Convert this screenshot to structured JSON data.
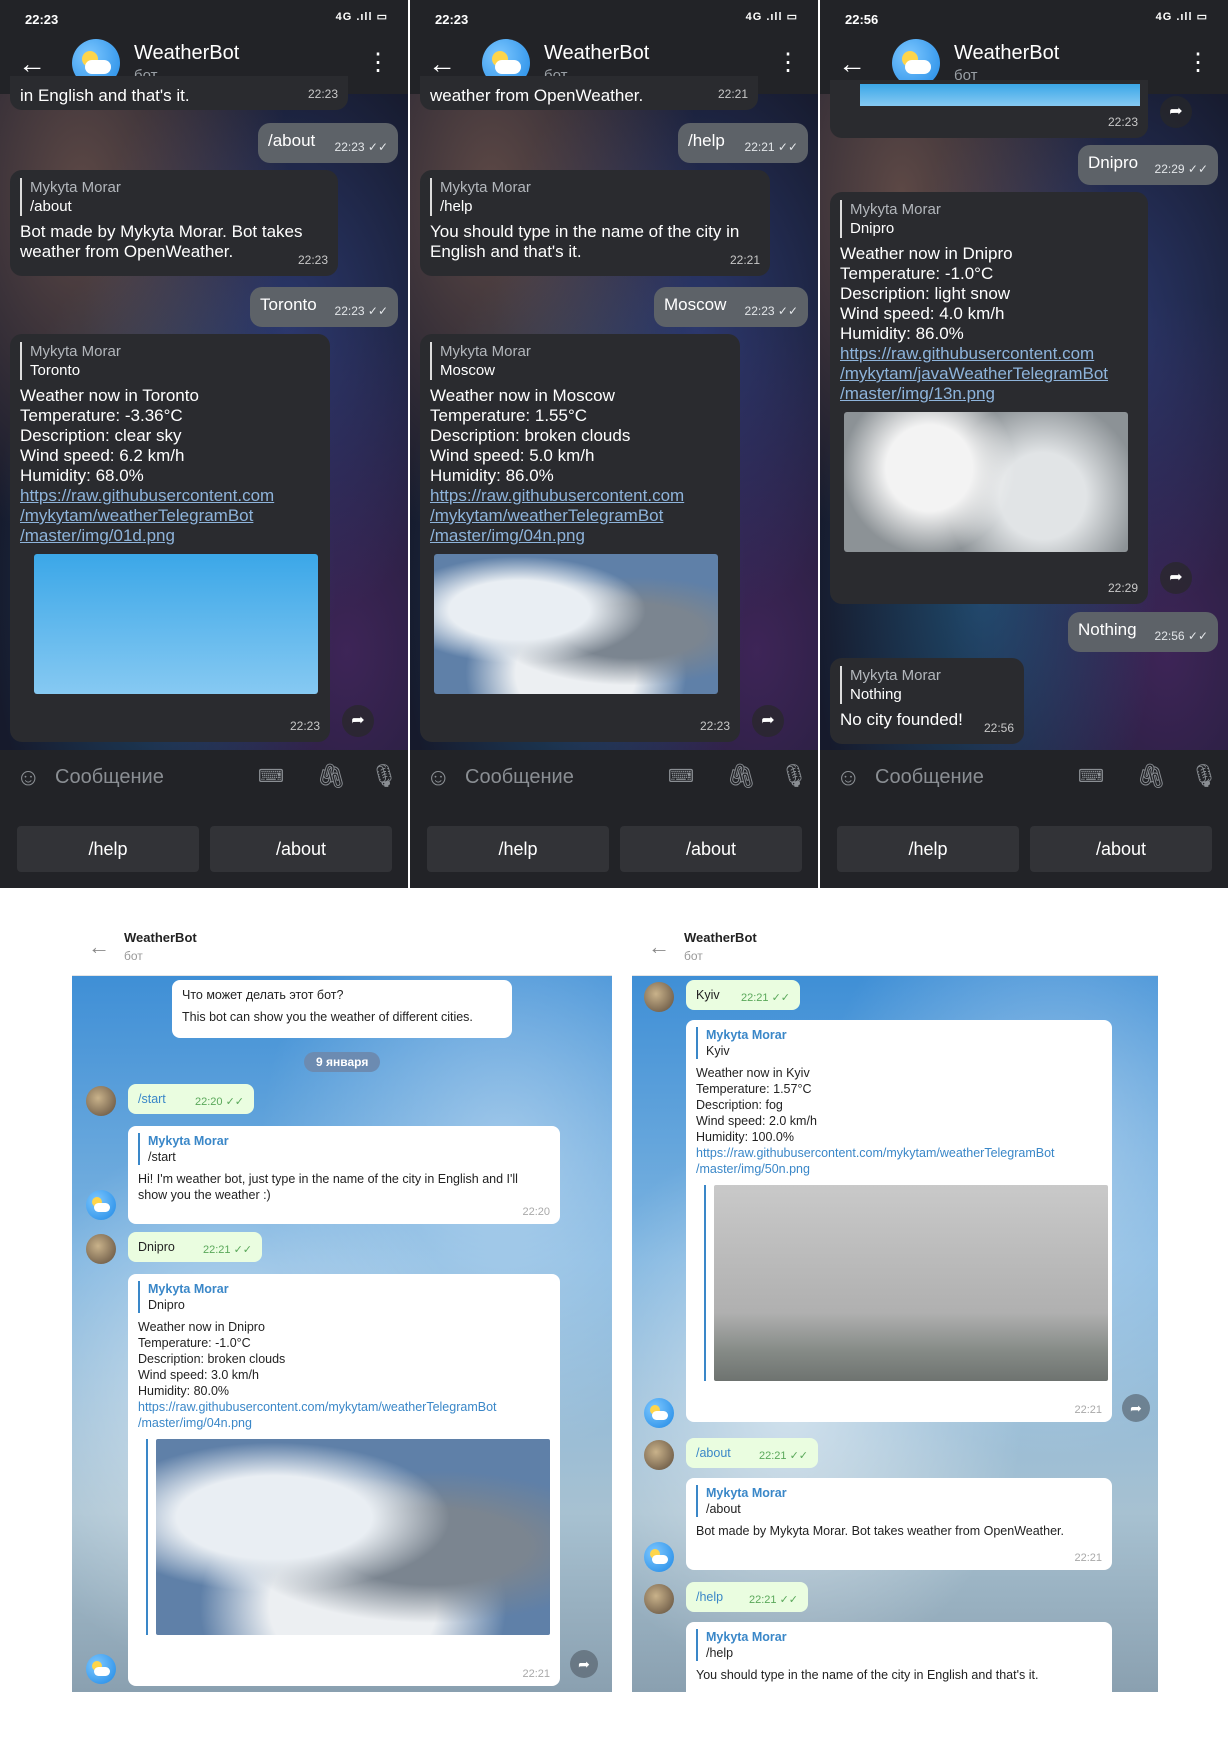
{
  "app": {
    "title": "WeatherBot",
    "subtitle": "бот",
    "input_placeholder": "Сообщение",
    "kbd_help": "/help",
    "kbd_about": "/about"
  },
  "icons": {
    "back": "←",
    "menu": "⋮",
    "emoji": "☺",
    "keyboard": "⌨",
    "clip": "🖇",
    "mic": "🎙",
    "share": "➦",
    "check": "✓✓"
  },
  "status": {
    "signal": "4G .ıll ▭"
  },
  "phone1": {
    "time": "22:23",
    "cut": "in English and that's it.",
    "cut_time": "22:23",
    "out1": "/about",
    "out1_time": "22:23",
    "r1_name": "Mykyta Morar",
    "r1_cmd": "/about",
    "r1_text": "Bot made by Mykyta Morar. Bot takes weather from OpenWeather.",
    "r1_time": "22:23",
    "out2": "Toronto",
    "out2_time": "22:23",
    "r2_name": "Mykyta Morar",
    "r2_cmd": "Toronto",
    "r2_lines": [
      "Weather now in Toronto",
      "Temperature:  -3.36°C",
      "Description: clear sky",
      "Wind speed: 6.2 km/h",
      "Humidity: 68.0%"
    ],
    "r2_link": [
      "https://raw.githubusercontent.com",
      "/mykytam/weatherTelegramBot",
      "/master/img/01d.png"
    ],
    "r2_time": "22:23"
  },
  "phone2": {
    "time": "22:23",
    "cut": "weather from OpenWeather.",
    "cut_time": "22:21",
    "out1": "/help",
    "out1_time": "22:21",
    "r1_name": "Mykyta Morar",
    "r1_cmd": "/help",
    "r1_text": "You should type in the name of the city in English and that's it.",
    "r1_time": "22:21",
    "out2": "Moscow",
    "out2_time": "22:23",
    "r2_name": "Mykyta Morar",
    "r2_cmd": "Moscow",
    "r2_lines": [
      "Weather now in Moscow",
      "Temperature:  1.55°C",
      "Description: broken clouds",
      "Wind speed: 5.0 km/h",
      "Humidity: 86.0%"
    ],
    "r2_link": [
      "https://raw.githubusercontent.com",
      "/mykytam/weatherTelegramBot",
      "/master/img/04n.png"
    ],
    "r2_time": "22:23"
  },
  "phone3": {
    "time": "22:56",
    "cut_time": "22:23",
    "out1": "Dnipro",
    "out1_time": "22:29",
    "r1_name": "Mykyta Morar",
    "r1_cmd": "Dnipro",
    "r1_lines": [
      "Weather now in Dnipro",
      "Temperature:  -1.0°C",
      "Description: light snow",
      "Wind speed: 4.0 km/h",
      "Humidity: 86.0%"
    ],
    "r1_link": [
      "https://raw.githubusercontent.com",
      "/mykytam/javaWeatherTelegramBot",
      "/master/img/13n.png"
    ],
    "r1_time": "22:29",
    "out2": "Nothing",
    "out2_time": "22:56",
    "r2_name": "Mykyta Morar",
    "r2_cmd": "Nothing",
    "r2_text": "No city founded!",
    "r2_time": "22:56"
  },
  "desk1": {
    "title": "WeatherBot",
    "subtitle": "бот",
    "intro_title": "Что может делать этот бот?",
    "intro_text": "This bot can show you the weather of different cities.",
    "date": "9 января",
    "out1": "/start",
    "out1_time": "22:20",
    "r1_name": "Mykyta Morar",
    "r1_cmd": "/start",
    "r1_text": "Hi! I'm weather bot, just type in the name of the city in English and I'll show you the weather :)",
    "r1_time": "22:20",
    "out2": "Dnipro",
    "out2_time": "22:21",
    "r2_name": "Mykyta Morar",
    "r2_cmd": "Dnipro",
    "r2_lines": [
      "Weather now in Dnipro",
      "Temperature:  -1.0°C",
      "Description: broken clouds",
      "Wind speed: 3.0 km/h",
      "Humidity: 80.0%"
    ],
    "r2_link": [
      "https://raw.githubusercontent.com/mykytam/weatherTelegramBot",
      "/master/img/04n.png"
    ],
    "r2_time": "22:21"
  },
  "desk2": {
    "title": "WeatherBot",
    "subtitle": "бот",
    "out1": "Kyiv",
    "out1_time": "22:21",
    "r1_name": "Mykyta Morar",
    "r1_cmd": "Kyiv",
    "r1_lines": [
      "Weather now in Kyiv",
      "Temperature:  1.57°C",
      "Description: fog",
      "Wind speed: 2.0 km/h",
      "Humidity: 100.0%"
    ],
    "r1_link": [
      "https://raw.githubusercontent.com/mykytam/weatherTelegramBot",
      "/master/img/50n.png"
    ],
    "r1_time": "22:21",
    "out2": "/about",
    "out2_time": "22:21",
    "r2_name": "Mykyta Morar",
    "r2_cmd": "/about",
    "r2_text": "Bot made by Mykyta Morar. Bot takes weather from OpenWeather.",
    "r2_time": "22:21",
    "out3": "/help",
    "out3_time": "22:21",
    "r3_name": "Mykyta Morar",
    "r3_cmd": "/help",
    "r3_text": "You should type in the name of the city in English and that's it."
  }
}
